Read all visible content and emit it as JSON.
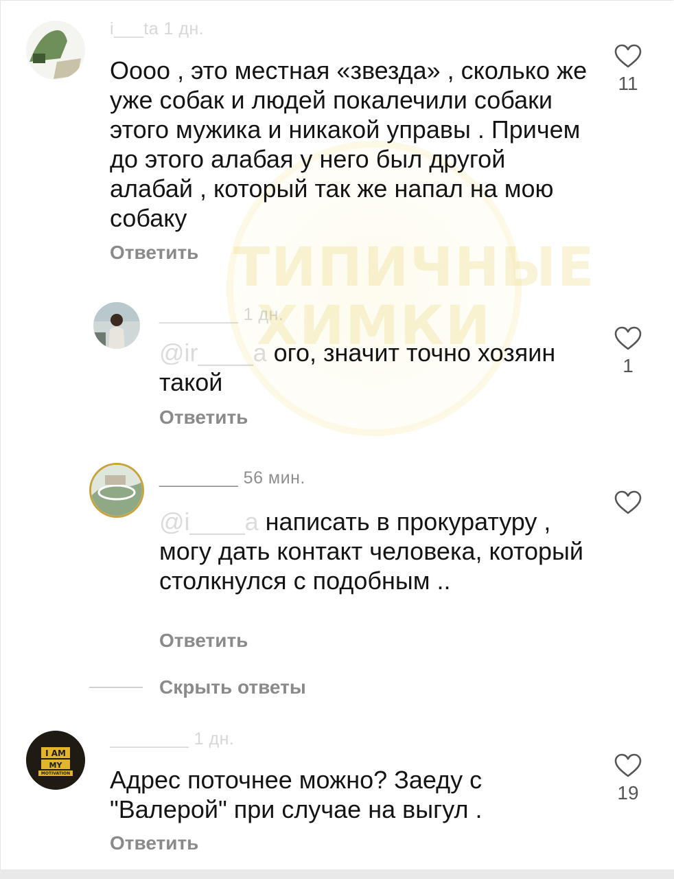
{
  "comments": [
    {
      "author_meta": "i___ta 1 дн.",
      "text": "Оооо , это местная «звезда» , сколько же уже собак и людей покалечили собаки этого мужика и никакой управы . Причем до этого алабая у него был другой алабай , который так же напал на мою собаку",
      "reply_label": "Ответить",
      "likes": "11"
    },
    {
      "author_meta": "________ 1 дн.",
      "mention": "@ir____a",
      "text": "ого, значит точно хозяин такой",
      "reply_label": "Ответить",
      "likes": "1"
    },
    {
      "author_meta": "________ 56 мин.",
      "mention": "@i____a",
      "text": "написать в прокуратуру , могу дать контакт человека, который столкнулся с подобным ..",
      "reply_label": "Ответить",
      "likes": ""
    },
    {
      "author_meta": "________ 1 дн.",
      "avatar_text": [
        "I AM",
        "MY",
        "MOTIVATION"
      ],
      "text": "Адрес поточнее можно? Заеду с \"Валерой\" при случае на выгул .",
      "reply_label": "Ответить",
      "likes": "19"
    }
  ],
  "hide_replies_label": "Скрыть ответы",
  "watermark": [
    "ТИПИЧНЫЕ",
    "ХИМКИ"
  ],
  "colors": {
    "text": "#141414",
    "meta": "#8e8e8e",
    "action": "#8a8a8a",
    "watermark": "#eedc8c"
  }
}
